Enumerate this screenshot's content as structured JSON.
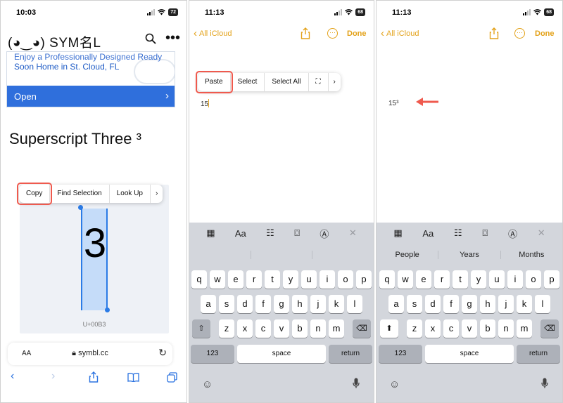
{
  "colors": {
    "accent": "#e3a21a",
    "highlight": "#ef5a4e",
    "link": "#2f6fdc",
    "keyboard": "#d3d6dc"
  },
  "panel1": {
    "time": "10:03",
    "battery": "72",
    "logo": "(◕‿◕) SYM名L",
    "ad_line1": "Enjoy a Professionally Designed Ready",
    "ad_line2": "Soon Home in St. Cloud, FL",
    "ad_button": "Open",
    "heading": "Superscript Three ³",
    "symbol": "3",
    "codepoint": "U+00B3",
    "menu": [
      "Copy",
      "Find Selection",
      "Look Up",
      "›"
    ],
    "url_aa": "AA",
    "url": "symbl.cc"
  },
  "panel2": {
    "time": "11:13",
    "battery": "68",
    "back_label": "All iCloud",
    "done_label": "Done",
    "menu": [
      "Paste",
      "Select",
      "Select All",
      "⛶",
      "›"
    ],
    "note_text": "15"
  },
  "panel3": {
    "time": "11:13",
    "battery": "68",
    "back_label": "All iCloud",
    "done_label": "Done",
    "note_text": "15³",
    "suggestions": [
      "People",
      "Years",
      "Months"
    ]
  },
  "keyboard": {
    "toolbar_icons": [
      "table-icon",
      "format-icon",
      "checklist-icon",
      "camera-icon",
      "markup-icon",
      "close-icon"
    ],
    "toolbar_format_label": "Aa",
    "row1": [
      "q",
      "w",
      "e",
      "r",
      "t",
      "y",
      "u",
      "i",
      "o",
      "p"
    ],
    "row2": [
      "a",
      "s",
      "d",
      "f",
      "g",
      "h",
      "j",
      "k",
      "l"
    ],
    "row3": [
      "z",
      "x",
      "c",
      "v",
      "b",
      "n",
      "m"
    ],
    "numbers_key": "123",
    "space_key": "space",
    "return_key": "return"
  }
}
